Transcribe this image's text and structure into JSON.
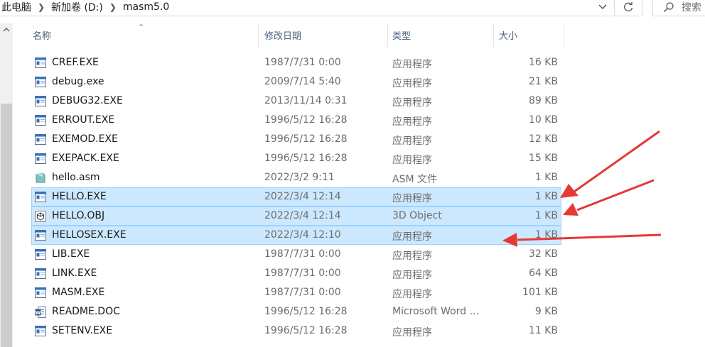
{
  "address_bar": {
    "crumbs": [
      "此电脑",
      "新加卷 (D:)",
      "masm5.0"
    ],
    "search_placeholder": "搜索"
  },
  "columns": {
    "name": "名称",
    "date": "修改日期",
    "type": "类型",
    "size": "大小"
  },
  "files": [
    {
      "name": "CREF.EXE",
      "date": "1987/7/31 0:00",
      "type": "应用程序",
      "size": "16 KB",
      "icon": "exe-icon",
      "selected": false
    },
    {
      "name": "debug.exe",
      "date": "2009/7/14 5:40",
      "type": "应用程序",
      "size": "21 KB",
      "icon": "exe-icon",
      "selected": false
    },
    {
      "name": "DEBUG32.EXE",
      "date": "2013/11/14 0:31",
      "type": "应用程序",
      "size": "89 KB",
      "icon": "exe-icon",
      "selected": false
    },
    {
      "name": "ERROUT.EXE",
      "date": "1996/5/12 16:28",
      "type": "应用程序",
      "size": "10 KB",
      "icon": "exe-icon",
      "selected": false
    },
    {
      "name": "EXEMOD.EXE",
      "date": "1996/5/12 16:28",
      "type": "应用程序",
      "size": "12 KB",
      "icon": "exe-icon",
      "selected": false
    },
    {
      "name": "EXEPACK.EXE",
      "date": "1996/5/12 16:28",
      "type": "应用程序",
      "size": "15 KB",
      "icon": "exe-icon",
      "selected": false
    },
    {
      "name": "hello.asm",
      "date": "2022/3/2 9:11",
      "type": "ASM 文件",
      "size": "1 KB",
      "icon": "asm-file-icon",
      "selected": false
    },
    {
      "name": "HELLO.EXE",
      "date": "2022/3/4 12:14",
      "type": "应用程序",
      "size": "1 KB",
      "icon": "exe-icon",
      "selected": true
    },
    {
      "name": "HELLO.OBJ",
      "date": "2022/3/4 12:14",
      "type": "3D Object",
      "size": "1 KB",
      "icon": "3d-object-icon",
      "selected": true
    },
    {
      "name": "HELLOSEX.EXE",
      "date": "2022/3/4 12:10",
      "type": "应用程序",
      "size": "1 KB",
      "icon": "exe-icon",
      "selected": true
    },
    {
      "name": "LIB.EXE",
      "date": "1987/7/31 0:00",
      "type": "应用程序",
      "size": "32 KB",
      "icon": "exe-icon",
      "selected": false
    },
    {
      "name": "LINK.EXE",
      "date": "1987/7/31 0:00",
      "type": "应用程序",
      "size": "64 KB",
      "icon": "exe-icon",
      "selected": false
    },
    {
      "name": "MASM.EXE",
      "date": "1987/7/31 0:00",
      "type": "应用程序",
      "size": "101 KB",
      "icon": "exe-icon",
      "selected": false
    },
    {
      "name": "README.DOC",
      "date": "1996/5/12 16:28",
      "type": "Microsoft Word ...",
      "size": "9 KB",
      "icon": "word-doc-icon",
      "selected": false
    },
    {
      "name": "SETENV.EXE",
      "date": "1996/5/12 16:28",
      "type": "应用程序",
      "size": "11 KB",
      "icon": "exe-icon",
      "selected": false
    }
  ],
  "colors": {
    "selection_bg": "#cce8ff",
    "selection_border": "#99d1ff",
    "annotation_arrow": "#e53935",
    "header_text": "#4c607a"
  }
}
